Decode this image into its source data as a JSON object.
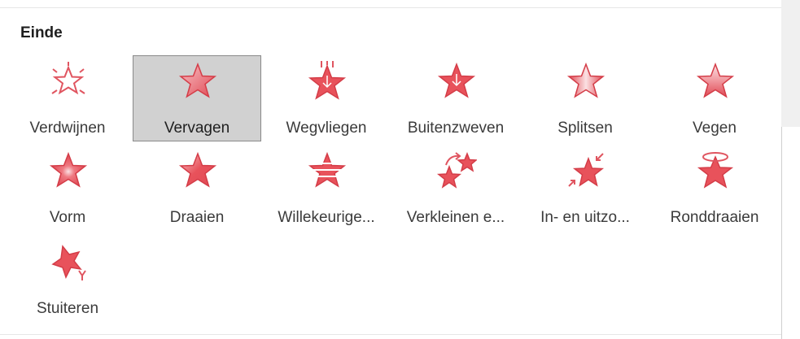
{
  "section": {
    "title": "Einde"
  },
  "colors": {
    "star_fill": "#e8525b",
    "star_stroke": "#d43d48",
    "selected_bg": "#d1d1d1"
  },
  "effects": [
    {
      "label": "Verdwijnen",
      "icon": "star-burst-outline-icon",
      "selected": false
    },
    {
      "label": "Vervagen",
      "icon": "star-fade-icon",
      "selected": true
    },
    {
      "label": "Wegvliegen",
      "icon": "star-fly-out-icon",
      "selected": false
    },
    {
      "label": "Buitenzweven",
      "icon": "star-float-out-icon",
      "selected": false
    },
    {
      "label": "Splitsen",
      "icon": "star-split-icon",
      "selected": false
    },
    {
      "label": "Vegen",
      "icon": "star-wipe-icon",
      "selected": false
    },
    {
      "label": "Vorm",
      "icon": "star-shape-icon",
      "selected": false
    },
    {
      "label": "Draaien",
      "icon": "star-wheel-icon",
      "selected": false
    },
    {
      "label": "Willekeurige...",
      "icon": "star-random-bars-icon",
      "selected": false
    },
    {
      "label": "Verkleinen e...",
      "icon": "star-shrink-turn-icon",
      "selected": false
    },
    {
      "label": "In- en uitzo...",
      "icon": "star-zoom-icon",
      "selected": false
    },
    {
      "label": "Ronddraaien",
      "icon": "star-swivel-icon",
      "selected": false
    },
    {
      "label": "Stuiteren",
      "icon": "star-bounce-icon",
      "selected": false
    }
  ]
}
